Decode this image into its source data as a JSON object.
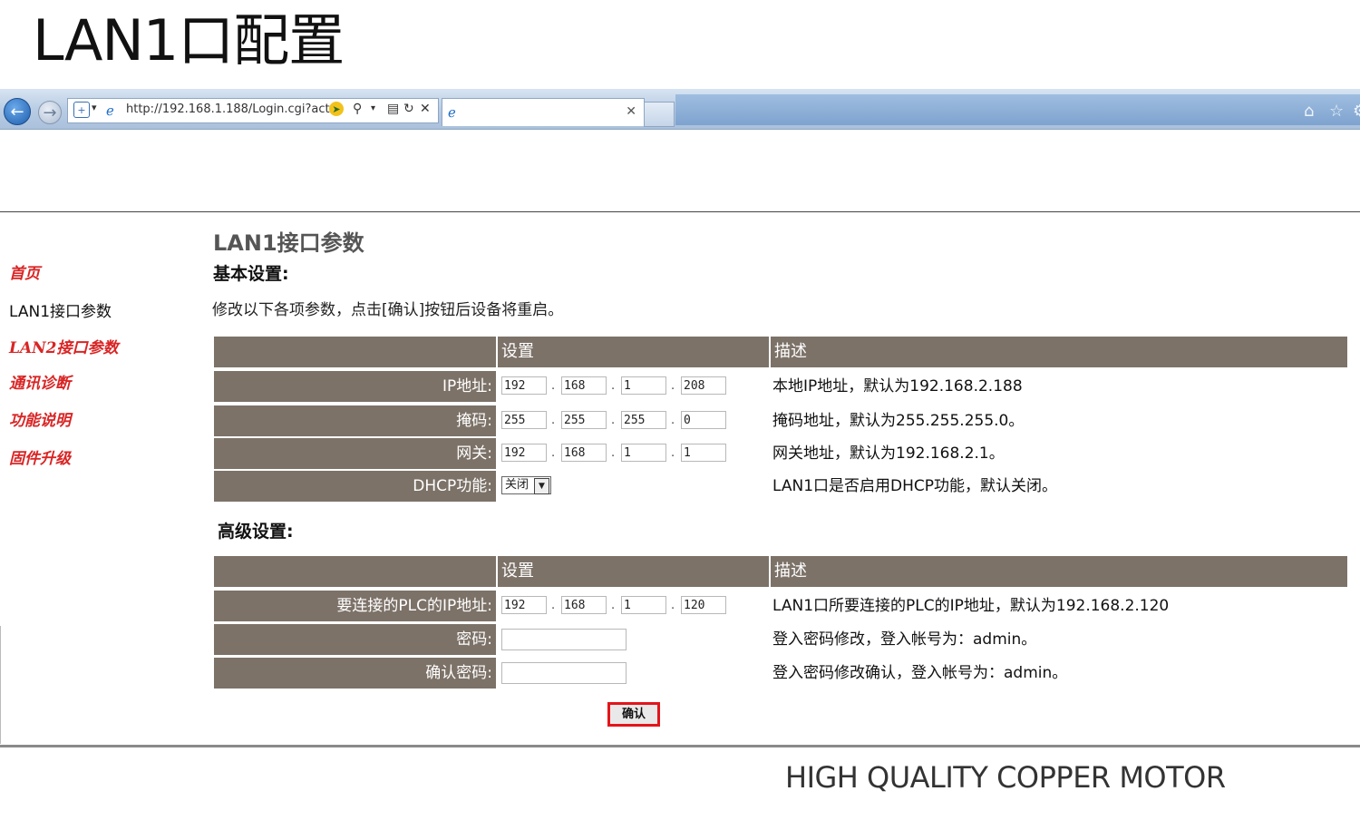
{
  "slide_title": "LAN1口配置",
  "browser": {
    "url": "http://192.168.1.188/Login.cgi?act",
    "tab_title": "",
    "colors": {
      "chrome": "#b9cde4"
    }
  },
  "sidebar": {
    "items": [
      {
        "label": "首页"
      },
      {
        "label": "LAN1接口参数"
      },
      {
        "label": "LAN2接口参数"
      },
      {
        "label": "通讯诊断"
      },
      {
        "label": "功能说明"
      },
      {
        "label": "固件升级"
      }
    ],
    "colors": {
      "link": "#d92525"
    }
  },
  "main": {
    "title": "LAN1接口参数",
    "basic_section": "基本设置:",
    "intro": "修改以下各项参数，点击[确认]按钮后设备将重启。",
    "header_set": "设置",
    "header_desc": "描述",
    "basic_rows": [
      {
        "label": "IP地址:",
        "ip": [
          "192",
          "168",
          "1",
          "208"
        ],
        "desc": "本地IP地址，默认为192.168.2.188"
      },
      {
        "label": "掩码:",
        "ip": [
          "255",
          "255",
          "255",
          "0"
        ],
        "desc": "掩码地址，默认为255.255.255.0。"
      },
      {
        "label": "网关:",
        "ip": [
          "192",
          "168",
          "1",
          "1"
        ],
        "desc": "网关地址，默认为192.168.2.1。"
      },
      {
        "label": "DHCP功能:",
        "select": "关闭",
        "desc": "LAN1口是否启用DHCP功能，默认关闭。"
      }
    ],
    "advanced_section": "高级设置:",
    "advanced_rows": [
      {
        "label": "要连接的PLC的IP地址:",
        "ip": [
          "192",
          "168",
          "1",
          "120"
        ],
        "desc": "LAN1口所要连接的PLC的IP地址，默认为192.168.2.120"
      },
      {
        "label": "密码:",
        "value": "",
        "desc": "登入密码修改，登入帐号为：admin。"
      },
      {
        "label": "确认密码:",
        "value": "",
        "desc": "登入密码修改确认，登入帐号为：admin。"
      }
    ],
    "confirm_label": "确认",
    "colors": {
      "table_header": "#7c7268",
      "confirm_border": "#e3151a"
    }
  },
  "tagline": "HIGH QUALITY COPPER MOTOR"
}
